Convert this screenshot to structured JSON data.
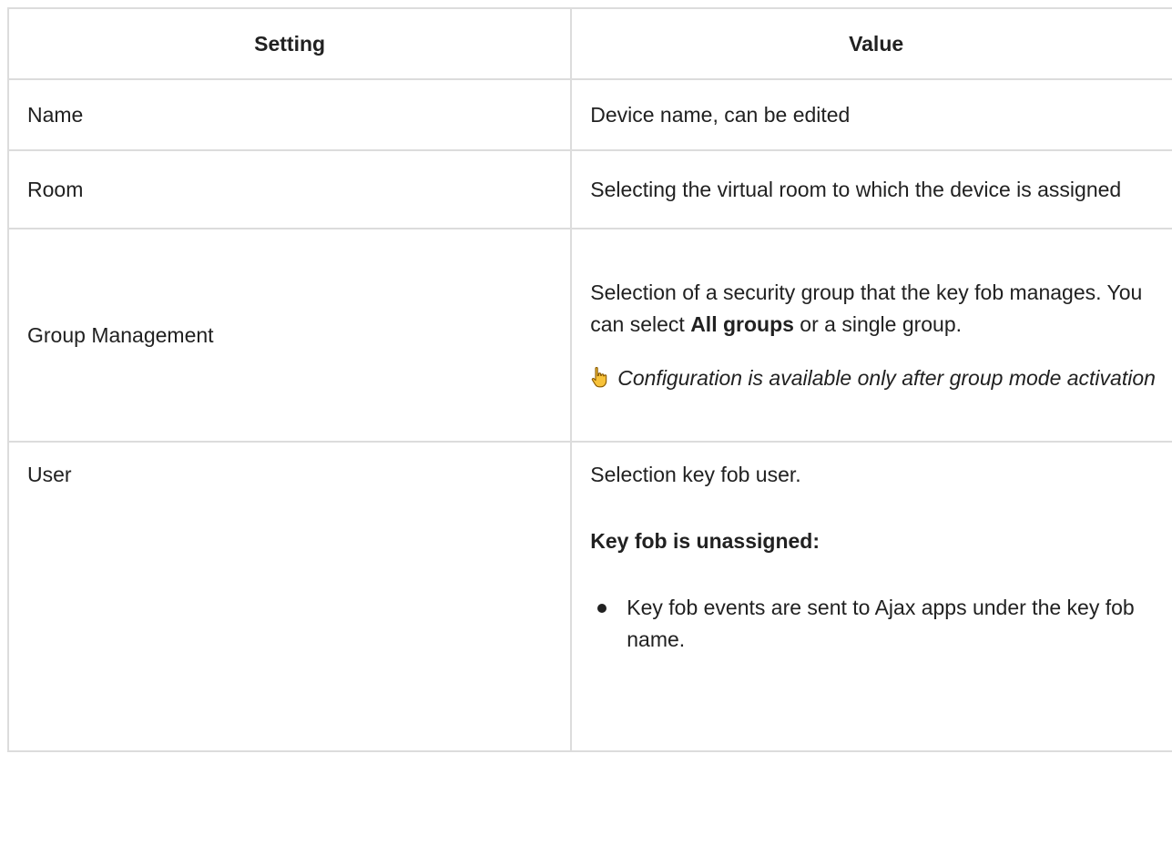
{
  "table": {
    "headers": {
      "setting": "Setting",
      "value": "Value"
    },
    "rows": {
      "name": {
        "setting": "Name",
        "value": "Device name, can be edited"
      },
      "room": {
        "setting": "Room",
        "value": "Selecting the virtual room to which the device is assigned"
      },
      "group": {
        "setting": "Group Management",
        "value_pre": "Selection of a security group that the key fob manages. You can select ",
        "value_bold": "All groups",
        "value_post": " or a single group.",
        "note": "Configuration is available only after group mode activation",
        "note_icon": "pointing-hand-icon"
      },
      "user": {
        "setting": "User",
        "intro": "Selection key fob user.",
        "subheading": "Key fob is unassigned:",
        "bullets": [
          "Key fob events are sent to Ajax apps under the key fob name."
        ]
      }
    }
  }
}
